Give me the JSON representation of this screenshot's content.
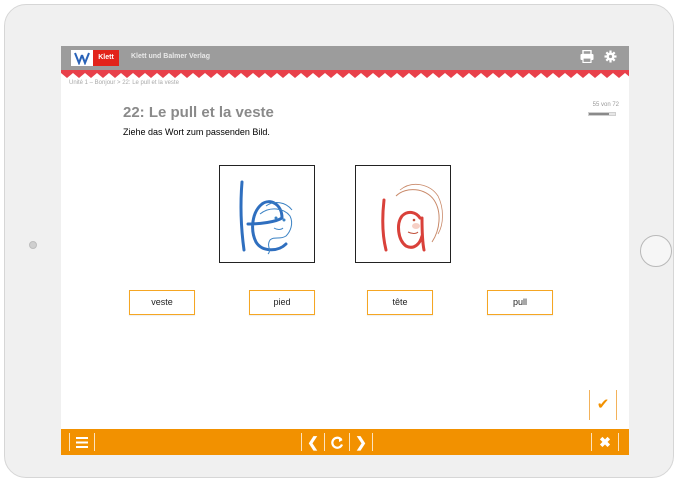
{
  "header": {
    "logo_text": "Klett",
    "publisher": "Klett und Balmer Verlag",
    "print_icon": "printer-icon",
    "settings_icon": "gear-icon"
  },
  "breadcrumb": "Unité 1 – Bonjour > 22: Le pull et la veste",
  "exercise": {
    "title": "22: Le pull et la veste",
    "instruction": "Ziehe das Wort zum passenden Bild.",
    "progress_text": "55 von 72",
    "progress_fraction": 0.76,
    "images": [
      {
        "name": "image-le",
        "word": "le",
        "color": "#2f6fbf"
      },
      {
        "name": "image-la",
        "word": "la",
        "color": "#d9413a"
      }
    ],
    "words": [
      "veste",
      "pied",
      "tête",
      "pull"
    ]
  },
  "footer": {
    "menu_icon": "menu-icon",
    "prev_icon": "chevron-left-icon",
    "reload_icon": "reload-icon",
    "next_icon": "chevron-right-icon",
    "close_icon": "close-icon",
    "check_icon": "check-icon"
  },
  "colors": {
    "accent": "#f29100",
    "topbar": "#9c9c9c",
    "brand_red": "#e2231a"
  }
}
